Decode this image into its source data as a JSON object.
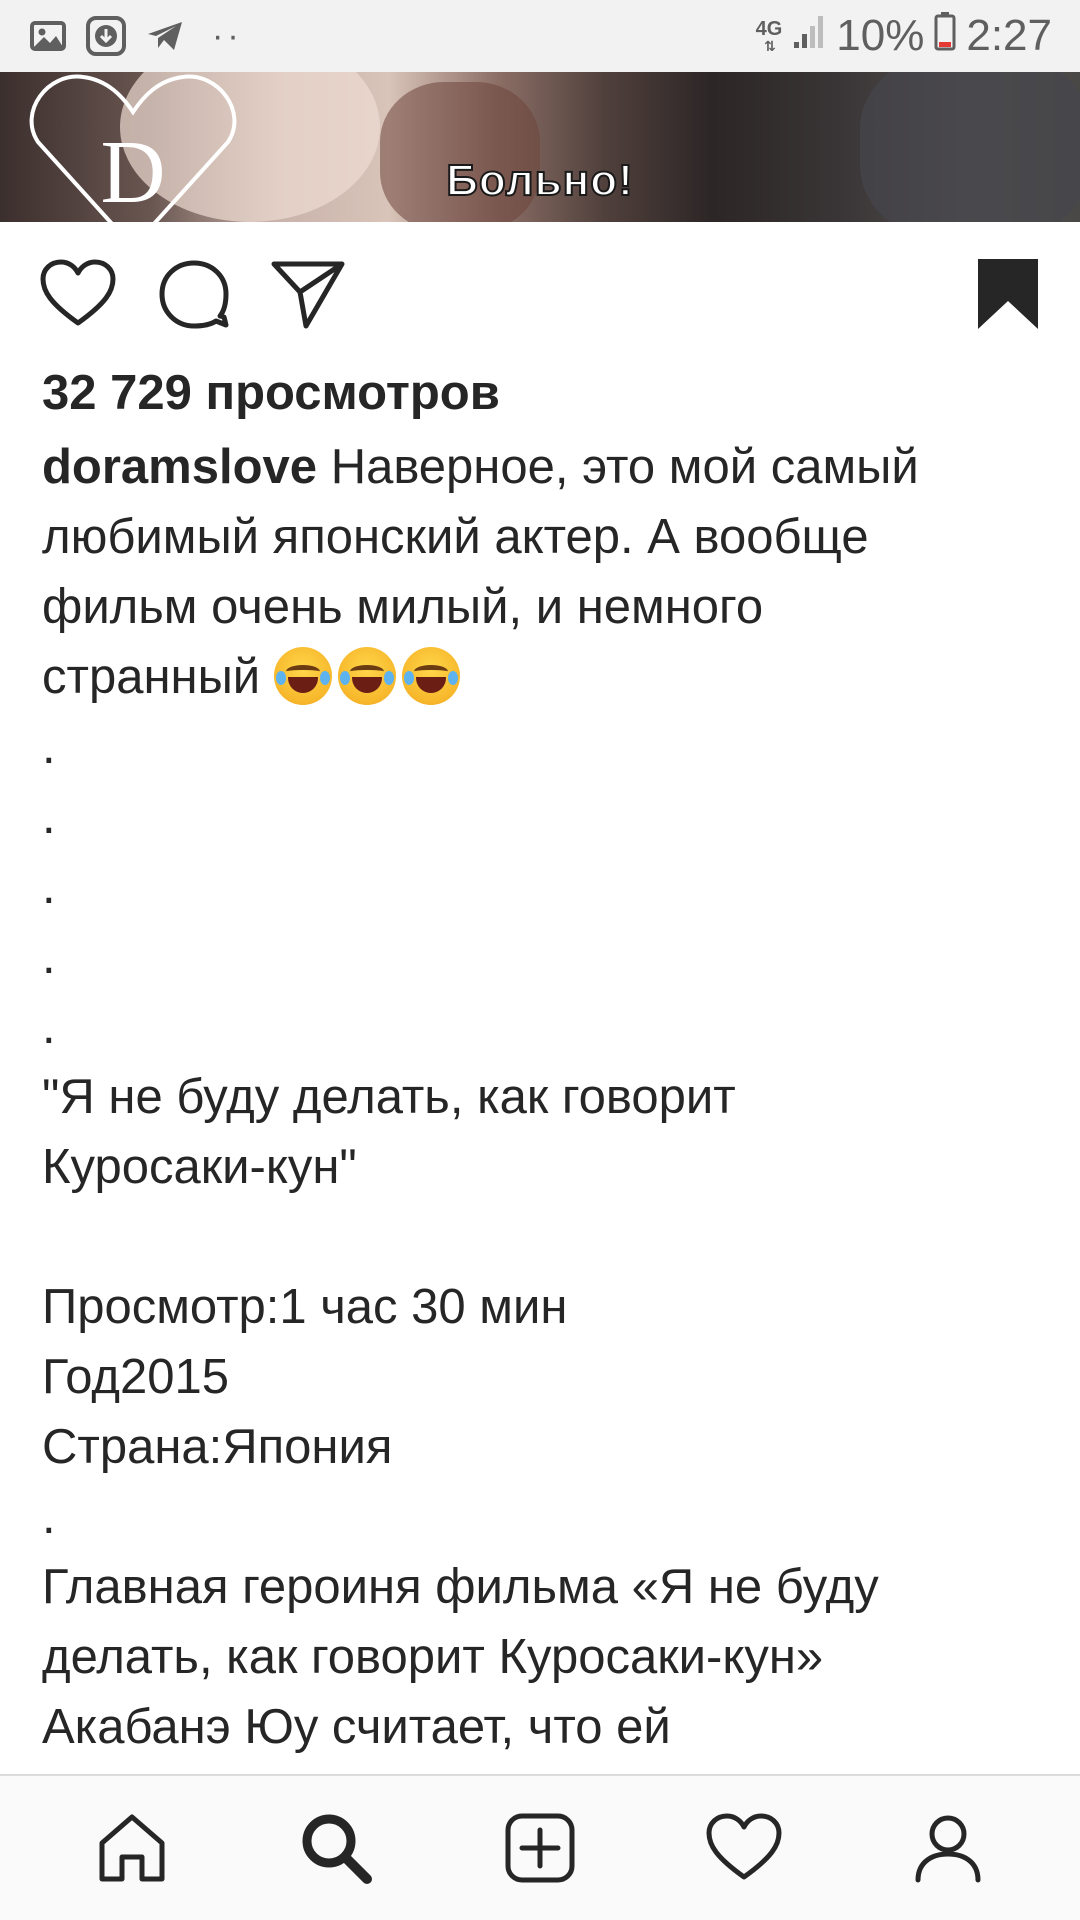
{
  "status_bar": {
    "network": "4G",
    "battery": "10%",
    "time": "2:27",
    "icons": [
      "gallery-icon",
      "download-icon",
      "telegram-icon",
      "more-dots-icon",
      "signal-icon",
      "battery-icon"
    ]
  },
  "media": {
    "subtitle": "Больно!",
    "logo_letter": "D"
  },
  "post": {
    "views": "32 729 просмотров",
    "username": "doramslove",
    "caption_lines": [
      "Наверное, это мой самый",
      "любимый японский актер. А вообще",
      "фильм очень милый, и немного",
      "странный"
    ],
    "emojis": [
      "face-with-tears-of-joy",
      "face-with-tears-of-joy",
      "face-with-tears-of-joy"
    ],
    "dots": [
      ".",
      ".",
      ".",
      ".",
      "."
    ],
    "quote_line1": "\"Я не буду делать, как говорит",
    "quote_line2": "Куросаки-кун\"",
    "duration": "Просмотр:1 час 30 мин",
    "year": "Год2015",
    "country": "Страна:Япония",
    "separator_dot": ".",
    "description_lines": [
      "Главная героиня фильма «Я не буду",
      "делать, как говорит Куросаки-кун»",
      "Акабанэ Юу считает, что ей"
    ]
  },
  "colors": {
    "text": "#262626",
    "status_bar_bg": "#f2f2f2",
    "nav_bg": "#fafafa",
    "icon": "#262626"
  },
  "bottom_nav": [
    "home-icon",
    "search-icon",
    "add-post-icon",
    "activity-heart-icon",
    "profile-icon"
  ]
}
